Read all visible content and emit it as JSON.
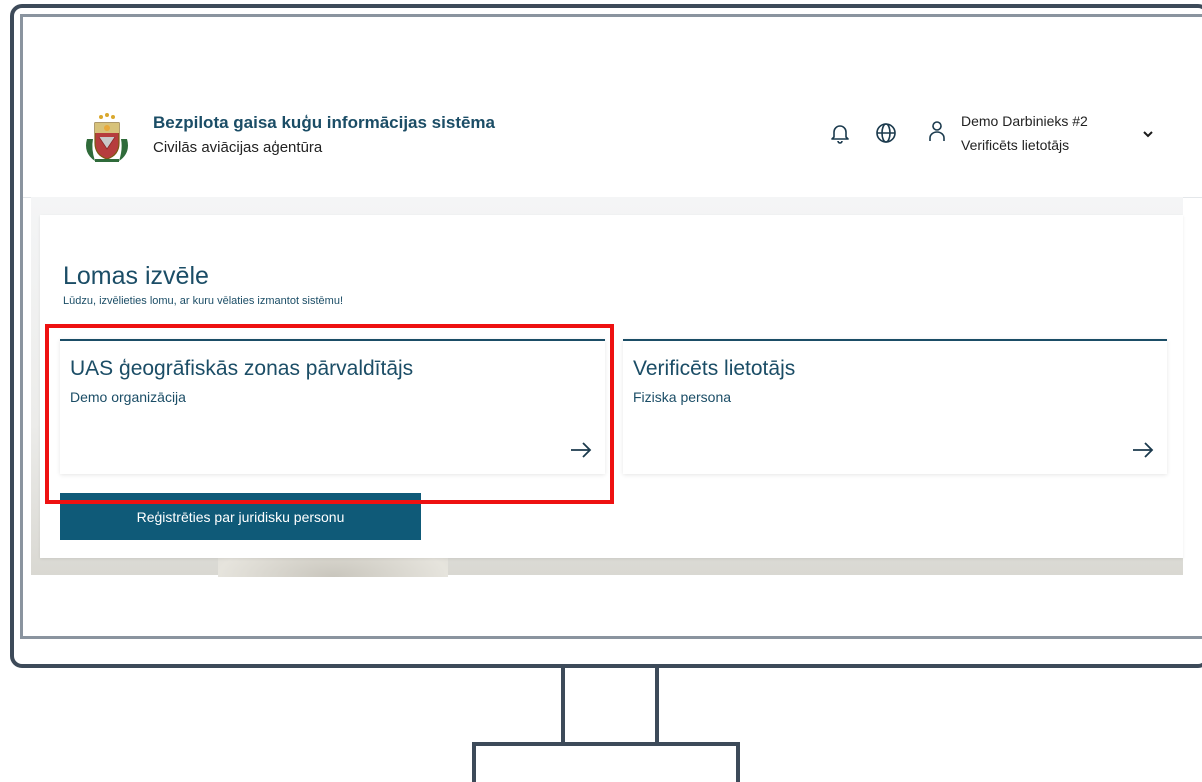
{
  "header": {
    "system_title": "Bezpilota gaisa kuģu informācijas sistēma",
    "agency_name": "Civilās aviācijas aģentūra",
    "user_name": "Demo Darbinieks #2",
    "user_role": "Verificēts lietotājs",
    "icons": [
      "coat-of-arms-logo",
      "bell-icon",
      "globe-icon",
      "user-icon",
      "chevron-down-icon"
    ]
  },
  "main": {
    "title": "Lomas izvēle",
    "subtitle": "Lūdzu, izvēlieties lomu, ar kuru vēlaties izmantot sistēmu!",
    "roles": [
      {
        "title": "UAS ģeogrāfiskās zonas pārvaldītājs",
        "organization": "Demo organizācija"
      },
      {
        "title": "Verificēts lietotājs",
        "organization": "Fiziska persona"
      }
    ],
    "register_button": "Reģistrēties par juridisku personu"
  },
  "colors": {
    "primary": "#1b4d66",
    "button": "#0f5a78",
    "highlight": "#ee1111",
    "frame": "#3d4a59"
  }
}
